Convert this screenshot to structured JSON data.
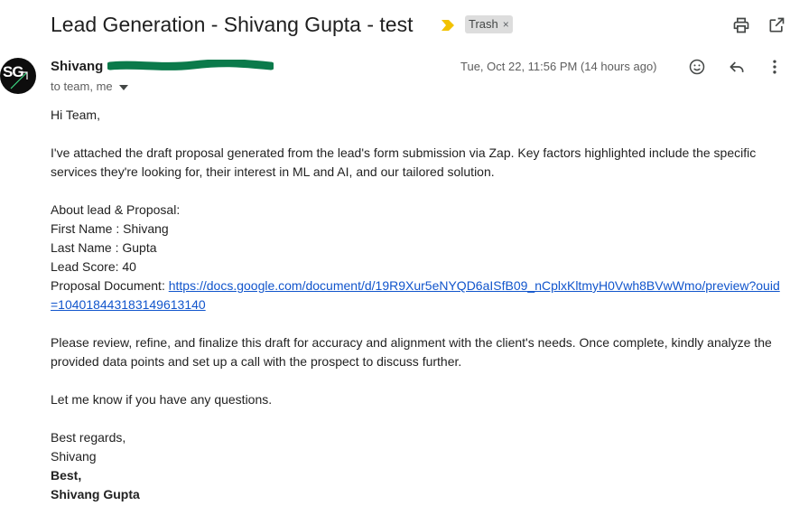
{
  "email": {
    "subject": "Lead Generation - Shivang Gupta - test",
    "label": "Trash",
    "label_remove": "×",
    "sender": {
      "name": "Shivang",
      "initials": "SG"
    },
    "recipients": "to team, me",
    "date": "Tue, Oct 22, 11:56 PM (14 hours ago)",
    "body": {
      "greeting": "Hi Team,",
      "intro": "I've attached the draft proposal generated from the lead's form submission via Zap. Key factors highlighted include the specific services they're looking for, their interest in ML and AI, and our tailored solution.",
      "about_heading": "About lead & Proposal:",
      "first_name": "First Name : Shivang",
      "last_name": "Last Name : Gupta",
      "lead_score": "Lead Score: 40",
      "proposal_label": "Proposal Document: ",
      "proposal_link": "https://docs.google.com/document/d/19R9Xur5eNYQD6aISfB09_nCplxKltmyH0Vwh8BVwWmo/preview?ouid=104018443183149613140",
      "request": "Please review, refine, and finalize this draft for accuracy and alignment with the client's needs. Once complete, kindly analyze the provided data points and set up a call with the prospect to discuss further.",
      "questions": "Let me know if you have any questions.",
      "signoff": "Best regards,",
      "signoff_name": "Shivang",
      "sig_best": "Best,",
      "sig_name": "Shivang Gupta"
    }
  },
  "icons": {
    "importance": "importance-marker-icon",
    "print": "print-icon",
    "open_new_window": "open-in-new-window-icon",
    "emoji": "emoji-reaction-icon",
    "reply": "reply-icon",
    "more": "more-vertical-icon",
    "recipients_caret": "chevron-down-icon"
  },
  "colors": {
    "link": "#1155cc",
    "importance": "#f2c200",
    "redaction": "#0b7a4b"
  }
}
